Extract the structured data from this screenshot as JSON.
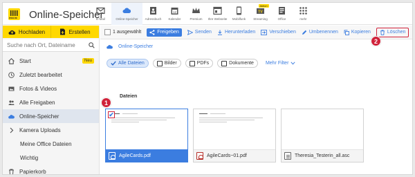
{
  "header": {
    "logo_text": "WEB.DE",
    "app_title": "Online-Speicher",
    "nav": [
      {
        "label": "E-Mail",
        "icon": "mail-icon"
      },
      {
        "label": "Online-Speicher",
        "icon": "cloud-icon"
      },
      {
        "label": "Adressbuch",
        "icon": "addressbook-icon"
      },
      {
        "label": "Kalender",
        "icon": "calendar-icon"
      },
      {
        "label": "Premium",
        "icon": "crown-icon"
      },
      {
        "label": "Ihre Webseite",
        "icon": "webpage-icon"
      },
      {
        "label": "Mobilfunk",
        "icon": "phone-icon"
      },
      {
        "label": "Streaming",
        "icon": "tv-icon",
        "badge": "Aktion"
      },
      {
        "label": "Office",
        "icon": "office-icon"
      },
      {
        "label": "mehr",
        "icon": "grid-icon"
      }
    ]
  },
  "sidebar": {
    "upload_label": "Hochladen",
    "create_label": "Erstellen",
    "search_placeholder": "Suche nach Ort, Dateiname",
    "items": [
      {
        "label": "Start",
        "badge": "Neu"
      },
      {
        "label": "Zuletzt bearbeitet"
      },
      {
        "label": "Fotos & Videos"
      },
      {
        "label": "Alle Freigaben"
      },
      {
        "label": "Online-Speicher"
      },
      {
        "label": "Kamera Uploads"
      },
      {
        "label": "Meine Office Dateien"
      },
      {
        "label": "Wichtig"
      },
      {
        "label": "Papierkorb"
      }
    ]
  },
  "toolbar": {
    "selected_count": "1 ausgewählt",
    "share": "Freigeben",
    "send": "Senden",
    "download": "Herunterladen",
    "move": "Verschieben",
    "rename": "Umbenennen",
    "copy": "Kopieren",
    "delete": "Löschen"
  },
  "main": {
    "breadcrumb": "Online-Speicher",
    "filters": [
      "Alle Dateien",
      "Bilder",
      "PDFs",
      "Dokumente"
    ],
    "more_filter": "Mehr Filter",
    "section_title": "Dateien",
    "files": [
      {
        "name": "AgileCards.pdf",
        "selected": true
      },
      {
        "name": "AgileCards~01.pdf",
        "selected": false
      },
      {
        "name": "Theresia_Testerin_all.asc",
        "selected": false
      }
    ]
  },
  "markers": [
    "1",
    "2"
  ],
  "colors": {
    "accent_yellow": "#ffd800",
    "accent_blue": "#3b7de0",
    "marker_red": "#d0223a"
  }
}
